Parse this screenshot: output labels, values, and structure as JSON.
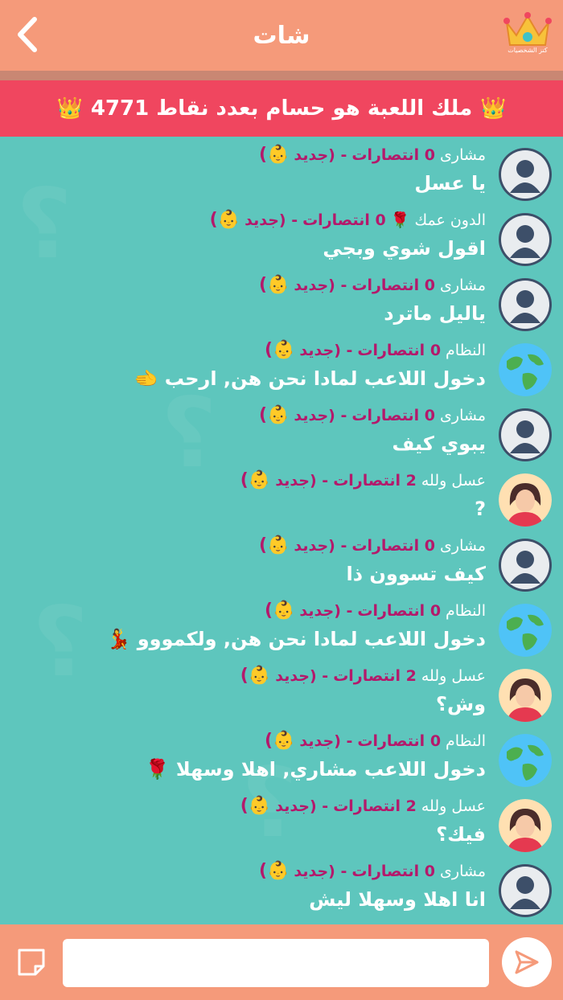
{
  "header": {
    "title": "شات",
    "back_icon": "chevron-left-icon",
    "logo_icon": "crown-logo-icon",
    "logo_text": "كنز الشخصيات"
  },
  "banner": {
    "icon_left": "👑",
    "icon_right": "👑",
    "text": "ملك اللعبة هو حسام  بعدد نقاط 4771"
  },
  "colors": {
    "header": "#f59a7a",
    "banner": "#f0465f",
    "chat_bg": "#5ec6bd",
    "wins": "#b4196b"
  },
  "messages": [
    {
      "user": "مشارى",
      "wins": "0 انتصارات",
      "status": "- (جديد",
      "badge": "👶)",
      "text": "يا عسل",
      "avatar": "default-avatar"
    },
    {
      "user": "الدون عمك 🌹",
      "wins": "0 انتصارات",
      "status": "- (جديد",
      "badge": "👶)",
      "text": "اقول شوي وبجي",
      "avatar": "default-avatar"
    },
    {
      "user": "مشارى",
      "wins": "0 انتصارات",
      "status": "- (جديد",
      "badge": "👶)",
      "text": "ياليل ماترد",
      "avatar": "default-avatar"
    },
    {
      "user": "النظام",
      "wins": "0 انتصارات",
      "status": "- (جديد",
      "badge": "👶)",
      "text": "دخول اللاعب لمادا نحن هن, ارحب 🫲",
      "avatar": "globe-avatar"
    },
    {
      "user": "مشارى",
      "wins": "0 انتصارات",
      "status": "- (جديد",
      "badge": "👶)",
      "text": "يبوي كيف",
      "avatar": "default-avatar"
    },
    {
      "user": "عسل ولله",
      "wins": "2 انتصارات",
      "status": "- (جديد",
      "badge": "👶)",
      "text": "?",
      "avatar": "woman-avatar"
    },
    {
      "user": "مشارى",
      "wins": "0 انتصارات",
      "status": "- (جديد",
      "badge": "👶)",
      "text": "كيف تسوون ذا",
      "avatar": "default-avatar"
    },
    {
      "user": "النظام",
      "wins": "0 انتصارات",
      "status": "- (جديد",
      "badge": "👶)",
      "text": "دخول اللاعب لمادا نحن هن, ولكمووو 💃",
      "avatar": "globe-avatar"
    },
    {
      "user": "عسل ولله",
      "wins": "2 انتصارات",
      "status": "- (جديد",
      "badge": "👶)",
      "text": "وش؟",
      "avatar": "woman-avatar"
    },
    {
      "user": "النظام",
      "wins": "0 انتصارات",
      "status": "- (جديد",
      "badge": "👶)",
      "text": "دخول اللاعب مشاري, اهلا وسهلا 🌹",
      "avatar": "globe-avatar"
    },
    {
      "user": "عسل ولله",
      "wins": "2 انتصارات",
      "status": "- (جديد",
      "badge": "👶)",
      "text": "فيك؟",
      "avatar": "woman-avatar"
    },
    {
      "user": "مشارى",
      "wins": "0 انتصارات",
      "status": "- (جديد",
      "badge": "👶)",
      "text": "انا اهلا وسهلا ليش",
      "avatar": "default-avatar"
    }
  ],
  "footer": {
    "input_placeholder": "",
    "sticker_icon": "sticker-icon",
    "send_icon": "send-icon"
  }
}
